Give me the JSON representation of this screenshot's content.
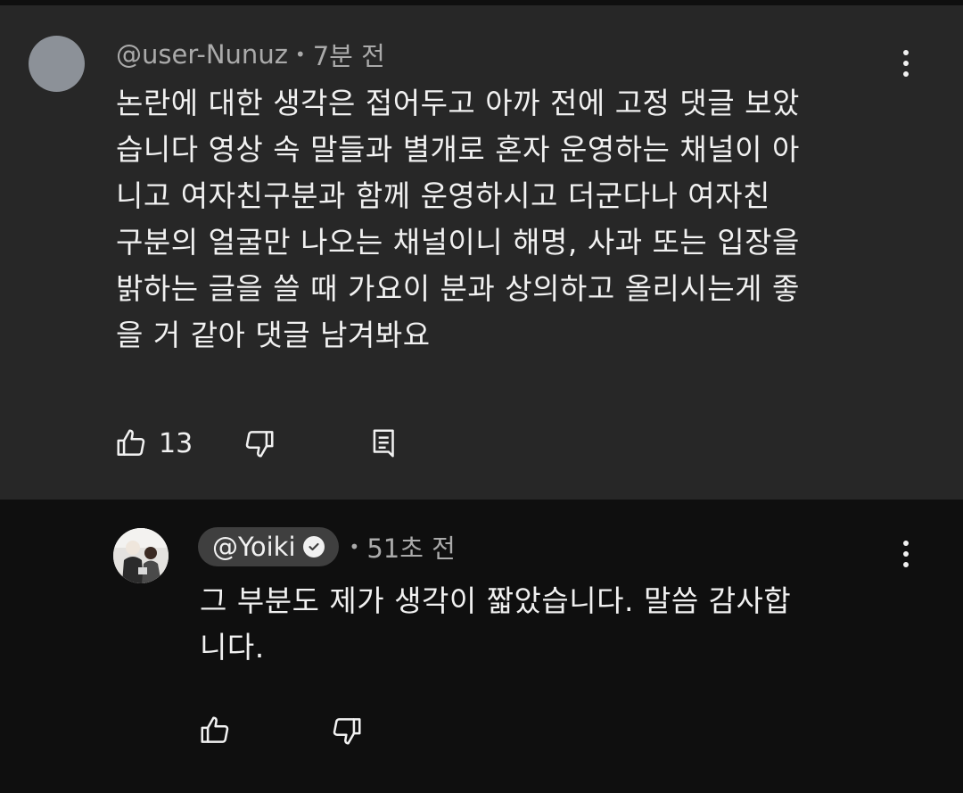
{
  "comment": {
    "author": "@user-Nunuz",
    "separator": "•",
    "time": "7분 전",
    "lines": [
      "논란에 대한 생각은 접어두고 아까 전에 고정 댓글 보았",
      "습니다 영상 속 말들과 별개로 혼자 운영하는 채널이 아",
      "니고 여자친구분과 함께 운영하시고 더군다나 여자친",
      "구분의 얼굴만 나오는 채널이니 해명, 사과 또는 입장을",
      "밝하는 글을 쓸 때 가요이 분과 상의하고 올리시는게 좋",
      "을 거 같아 댓글 남겨봐요"
    ],
    "like_count": "13",
    "icons": {
      "like": "thumbs-up-icon",
      "dislike": "thumbs-down-icon",
      "reply": "reply-comment-icon",
      "more": "more-vertical-icon"
    }
  },
  "reply": {
    "author": "@Yoiki",
    "separator": "•",
    "time": "51초 전",
    "lines": [
      "그 부분도 제가 생각이 짧았습니다. 말씀 감사합",
      "니다."
    ],
    "icons": {
      "verified": "verified-check-icon",
      "like": "thumbs-up-icon",
      "dislike": "thumbs-down-icon",
      "more": "more-vertical-icon"
    }
  },
  "colors": {
    "comment_bg": "#272727",
    "page_bg": "#0f0f0f",
    "text_primary": "#f1f1f1",
    "text_secondary": "#aaaaaa",
    "chip_bg": "#3f3f3f"
  }
}
